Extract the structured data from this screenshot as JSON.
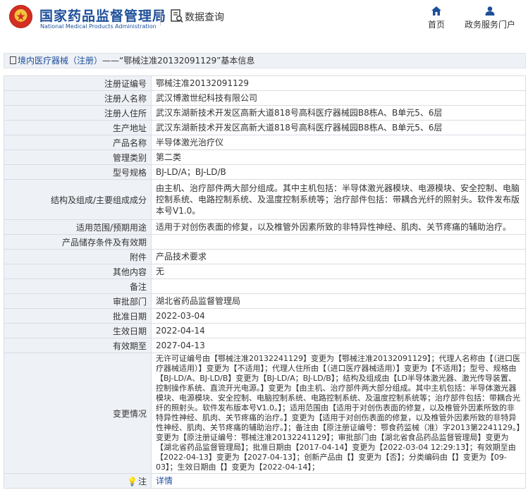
{
  "header": {
    "site_name_cn": "国家药品监督管理局",
    "site_name_en": "National Medical Products Administration",
    "db_title": "数据查询",
    "nav": [
      {
        "label": "首页",
        "icon": "home-icon"
      },
      {
        "label": "政务服务门户",
        "icon": "user-icon"
      }
    ]
  },
  "breadcrumb": {
    "category": "境内医疗器械（注册）",
    "dash": "——",
    "title": "“鄂械注准20132091129”基本信息"
  },
  "fields": [
    {
      "label": "注册证编号",
      "value": "鄂械注准20132091129"
    },
    {
      "label": "注册人名称",
      "value": "武汉博激世纪科技有限公司"
    },
    {
      "label": "注册人住所",
      "value": "武汉东湖新技术开发区高新大道818号高科医疗器械园B8栋A、B单元5、6层"
    },
    {
      "label": "生产地址",
      "value": "武汉东湖新技术开发区高新大道818号高科医疗器械园B8栋A、B单元5、6层"
    },
    {
      "label": "产品名称",
      "value": "半导体激光治疗仪"
    },
    {
      "label": "管理类别",
      "value": "第二类"
    },
    {
      "label": "型号规格",
      "value": "BJ-LD/A；BJ-LD/B"
    },
    {
      "label": "结构及组成/主要组成成分",
      "value": "由主机、治疗部件两大部分组成。其中主机包括：半导体激光器模块、电源模块、安全控制、电脑控制系统、电路控制系统、及温度控制系统等；治疗部件包括：带耦合光纤的照射头。软件发布版本号V1.0。"
    },
    {
      "label": "适用范围/预期用途",
      "value": "适用于对创伤表面的修复，以及椎管外因素所致的非特异性神经、肌肉、关节疼痛的辅助治疗。"
    },
    {
      "label": "产品储存条件及有效期",
      "value": ""
    },
    {
      "label": "附件",
      "value": "产品技术要求"
    },
    {
      "label": "其他内容",
      "value": "无"
    },
    {
      "label": "备注",
      "value": ""
    },
    {
      "label": "审批部门",
      "value": "湖北省药品监督管理局"
    },
    {
      "label": "批准日期",
      "value": "2022-03-04"
    },
    {
      "label": "生效日期",
      "value": "2022-04-14"
    },
    {
      "label": "有效期至",
      "value": "2027-04-13"
    },
    {
      "label": "变更情况",
      "value": "无许可证编号由【鄂械注准20132241129】变更为【鄂械注准20132091129】；代理人名称由【（进口医疗器械适用）】变更为【不适用】；代理人住所由【（进口医疗器械适用）】变更为【不适用】；型号、规格由【BJ-LD/A、BJ-LD/B】变更为【BJ-LD/A；BJ-LD/B】；结构及组成由【LD半导体激光器、激光传导装置、控制操作系统、直流开光电源。】变更为【由主机、治疗部件两大部分组成。其中主机包括：半导体激光器模块、电源模块、安全控制、电脑控制系统、电路控制系统、及温度控制系统等；治疗部件包括：带耦合光纤的照射头。软件发布版本号V1.0。】；适用范围由【适用于对创伤表面的修复，以及椎管外因素所致的非特异性神经、肌肉、关节疼痛的治疗。】变更为【适用于对创伤表面的修复，以及椎管外因素所致的非特异性神经、肌肉、关节疼痛的辅助治疗。】；备注由【原注册证编号：鄂食药监械（准）字2013第2241129。】变更为【原注册证编号：鄂械注准20132241129】；审批部门由【湖北省食品药品监督管理局】变更为【湖北省药品监督管理局】；批准日期由【2017-04-14】变更为【2022-03-04 12:29:13】；有效期至由【2022-04-13】变更为【2027-04-13】；创新产品由【】变更为【否】；分类编码由【】变更为【09-03】；生效日期由【】变更为【2022-04-14】；"
    }
  ],
  "note": {
    "label": "注",
    "link": "详情"
  }
}
